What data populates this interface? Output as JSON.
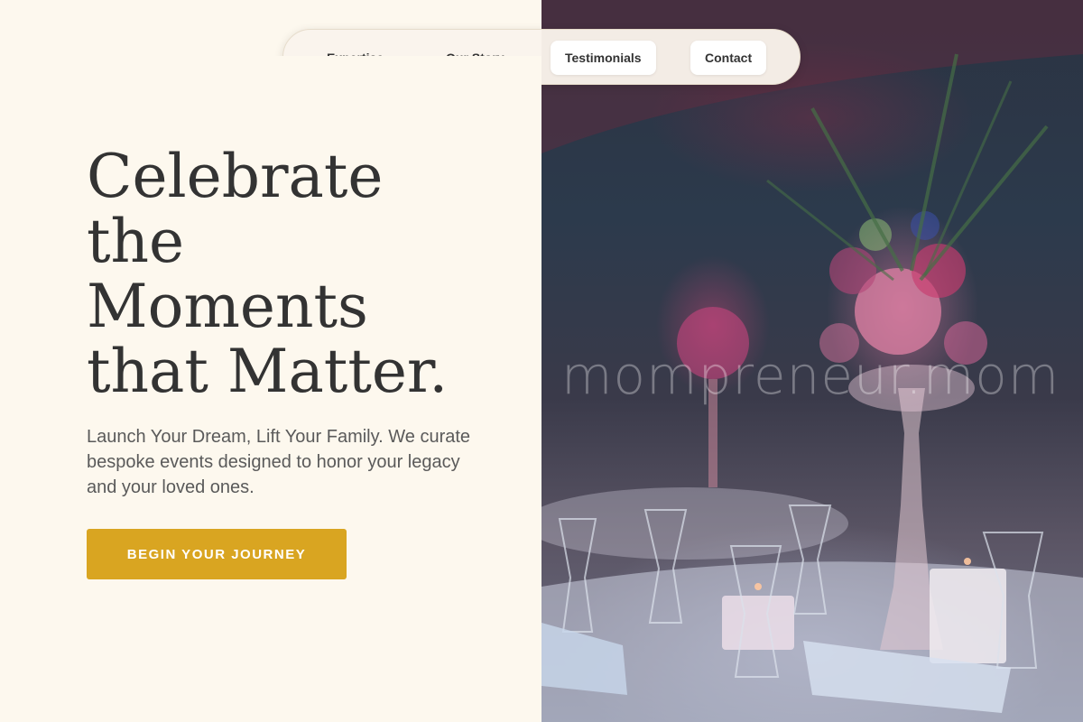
{
  "nav": {
    "items": [
      {
        "label": "Expertise"
      },
      {
        "label": "Our Story"
      },
      {
        "label": "Testimonials"
      },
      {
        "label": "Contact"
      }
    ]
  },
  "hero": {
    "headline_lines": [
      "Celebrate",
      "the",
      "Moments",
      "that Matter."
    ],
    "subtext": "Launch Your Dream, Lift Your Family. We curate bespoke events designed to honor your legacy and your loved ones.",
    "cta_label": "BEGIN YOUR JOURNEY"
  },
  "photo": {
    "watermark": "mompreneur.mom"
  },
  "colors": {
    "background": "#fdf8ee",
    "accent": "#d9a521",
    "heading": "#333333",
    "body_text": "#5a5a5a"
  }
}
